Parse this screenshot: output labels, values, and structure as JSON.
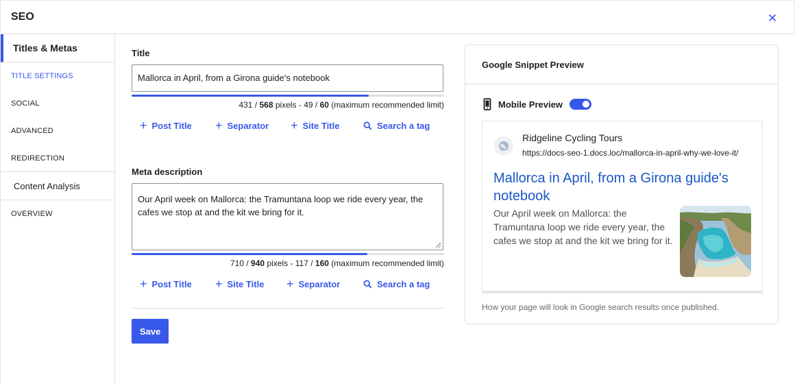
{
  "header": {
    "title": "SEO"
  },
  "sidebar": {
    "tabs": [
      {
        "label": "Titles & Metas"
      },
      {
        "label": "Content Analysis"
      }
    ],
    "sub_items": [
      "TITLE SETTINGS",
      "SOCIAL",
      "ADVANCED",
      "REDIRECTION"
    ],
    "overview": "OVERVIEW"
  },
  "title_field": {
    "label": "Title",
    "value": "Mallorca in April, from a Girona guide's notebook",
    "pixels_used": "431",
    "pixels_max": "568",
    "chars_used": "49",
    "chars_max": "60",
    "pixels_fill": 0.759,
    "pixels_word": "pixels",
    "limit_note": "(maximum recommended limit)",
    "tags": [
      "Post Title",
      "Separator",
      "Site Title",
      "Search a tag"
    ]
  },
  "meta_field": {
    "label": "Meta description",
    "value": "Our April week on Mallorca: the Tramuntana loop we ride every year, the cafes we stop at and the kit we bring for it.",
    "pixels_used": "710",
    "pixels_max": "940",
    "chars_used": "117",
    "chars_max": "160",
    "pixels_fill": 0.755,
    "pixels_word": "pixels",
    "limit_note": "(maximum recommended limit)",
    "tags": [
      "Post Title",
      "Site Title",
      "Separator",
      "Search a tag"
    ]
  },
  "save_label": "Save",
  "preview": {
    "title": "Google Snippet Preview",
    "mobile_label": "Mobile Preview",
    "mobile_enabled": true,
    "site_name": "Ridgeline Cycling Tours",
    "url": "https://docs-seo-1.docs.loc/mallorca-in-april-why-we-love-it/",
    "snippet_title": "Mallorca in April, from a Girona guide's notebook",
    "snippet_desc": "Our April week on Mallorca: the Tramuntana loop we ride every year, the cafes we stop at and the kit we bring for it.",
    "footer": "How your page will look in Google search results once published."
  },
  "colors": {
    "accent": "#3858e9",
    "link": "#1a57c7"
  }
}
